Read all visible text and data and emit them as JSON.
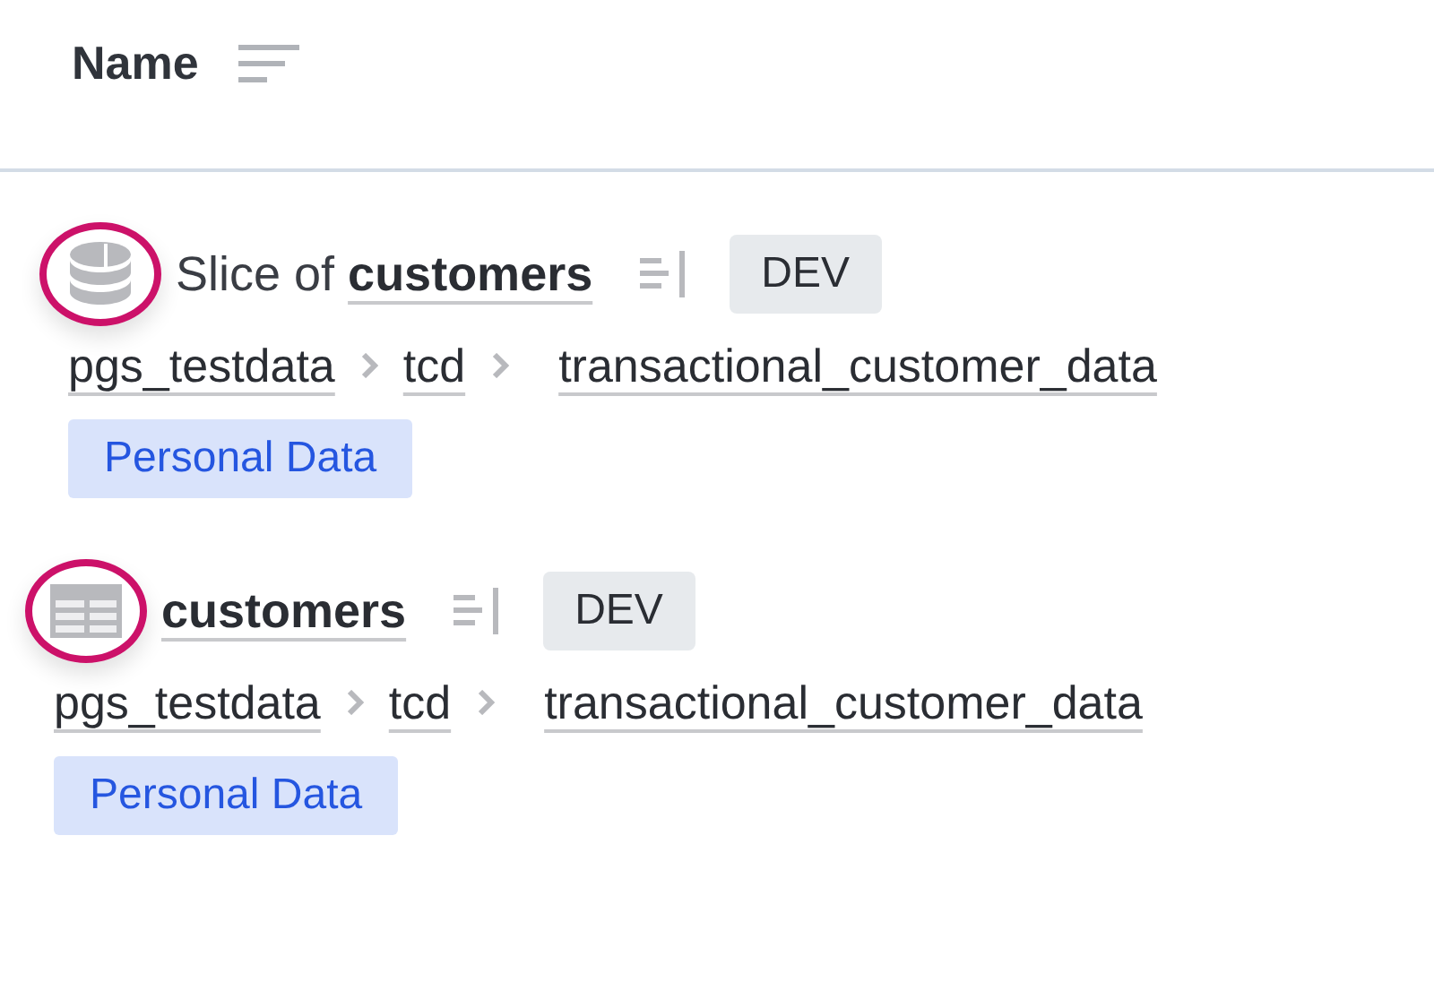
{
  "header": {
    "label": "Name"
  },
  "items": [
    {
      "kind": "slice",
      "highlighted": true,
      "title_prefix": "Slice of ",
      "title_link": "customers",
      "env": "DEV",
      "path": [
        "pgs_testdata",
        "tcd",
        "transactional_customer_data"
      ],
      "tags": [
        "Personal Data"
      ]
    },
    {
      "kind": "table",
      "highlighted": true,
      "title_link": "customers",
      "env": "DEV",
      "path": [
        "pgs_testdata",
        "tcd",
        "transactional_customer_data"
      ],
      "tags": [
        "Personal Data"
      ]
    }
  ]
}
